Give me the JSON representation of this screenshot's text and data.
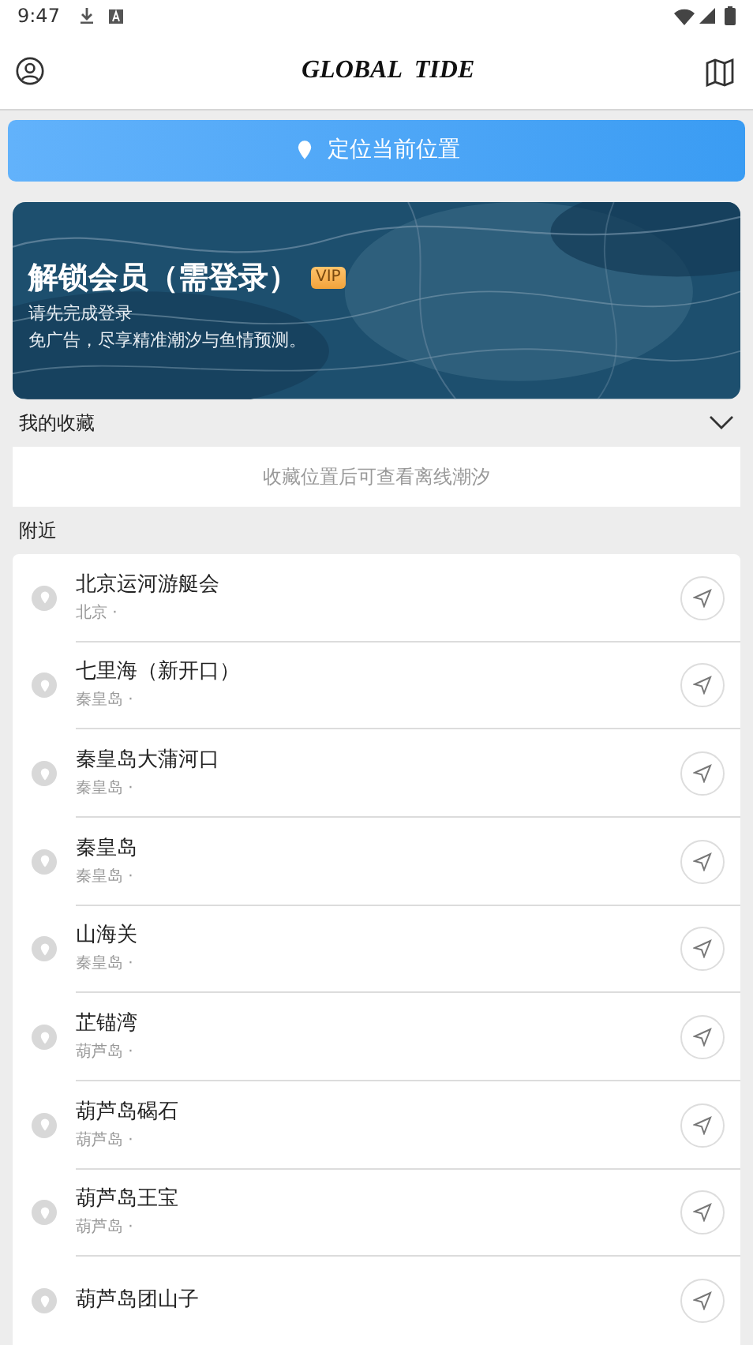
{
  "status_bar": {
    "time": "9:47"
  },
  "header": {
    "title": "GLOBAL  TIDE"
  },
  "locate_button": {
    "label": "定位当前位置"
  },
  "banner": {
    "kind": "picture",
    "title": "解锁会员（需登录）",
    "badge": "VIP",
    "lines": [
      "请先完成登录",
      "免广告，尽享精准潮汐与鱼情预测。"
    ]
  },
  "favorites": {
    "title": "我的收藏",
    "expanded": true,
    "empty_text": "收藏位置后可查看离线潮汐"
  },
  "nearby": {
    "title": "附近",
    "items": [
      {
        "name": "北京运河游艇会",
        "region": "北京 ·"
      },
      {
        "name": "七里海（新开口）",
        "region": "秦皇岛 ·"
      },
      {
        "name": "秦皇岛大蒲河口",
        "region": "秦皇岛 ·"
      },
      {
        "name": "秦皇岛",
        "region": "秦皇岛 ·"
      },
      {
        "name": "山海关",
        "region": "秦皇岛 ·"
      },
      {
        "name": "芷锚湾",
        "region": "葫芦岛 ·"
      },
      {
        "name": "葫芦岛碣石",
        "region": "葫芦岛 ·"
      },
      {
        "name": "葫芦岛王宝",
        "region": "葫芦岛 ·"
      },
      {
        "name": "葫芦岛团山子"
      }
    ]
  }
}
